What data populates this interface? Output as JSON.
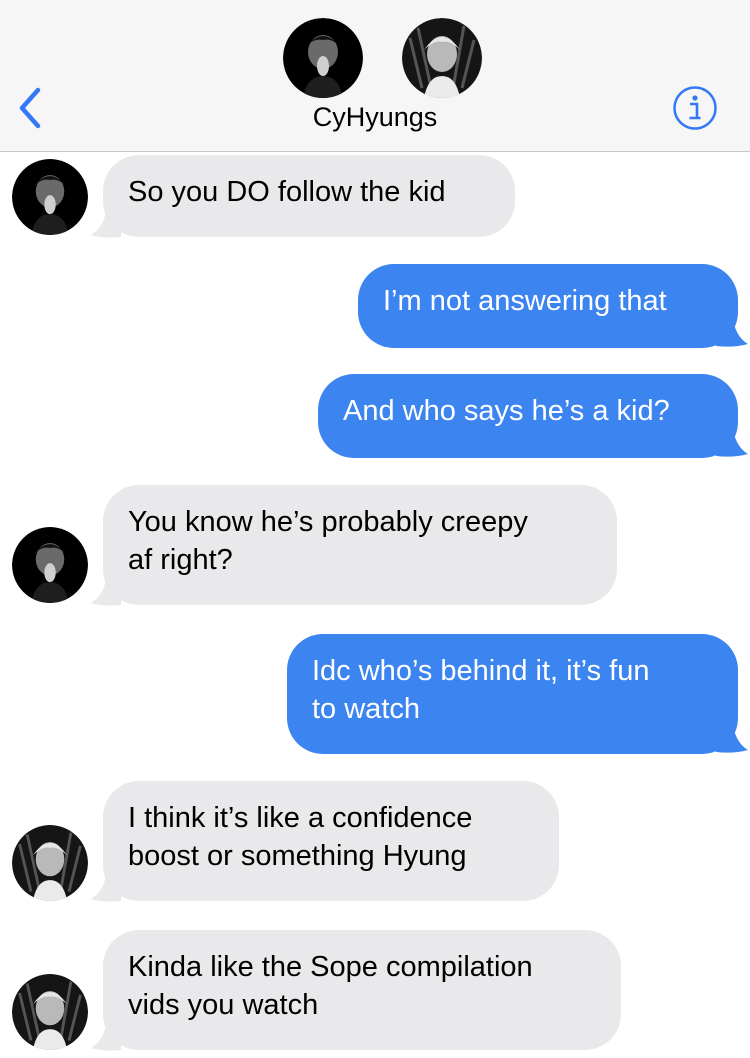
{
  "header": {
    "title": "CyHyungs",
    "back_icon": "chevron-left-icon",
    "info_icon": "info-circle-icon",
    "accent_color": "#3478f6"
  },
  "messages": [
    {
      "direction": "incoming",
      "sender": "black-haired",
      "text": "So you DO follow the kid"
    },
    {
      "direction": "outgoing",
      "text": "I’m not answering that"
    },
    {
      "direction": "outgoing",
      "text": "And who says he’s a kid?"
    },
    {
      "direction": "incoming",
      "sender": "black-haired",
      "lines": [
        "You know he’s probably creepy",
        "af right?"
      ]
    },
    {
      "direction": "outgoing",
      "lines": [
        "Idc who’s behind it, it’s fun",
        "to watch"
      ]
    },
    {
      "direction": "incoming",
      "sender": "silver-haired",
      "lines": [
        "I think it’s like a confidence",
        "boost or something Hyung"
      ]
    },
    {
      "direction": "incoming",
      "sender": "silver-haired",
      "lines": [
        "Kinda like the Sope compilation",
        "vids you watch"
      ]
    }
  ],
  "colors": {
    "incoming_bubble": "#e9e9eb",
    "outgoing_bubble": "#3c84f0",
    "header_bg": "#f6f6f6"
  }
}
